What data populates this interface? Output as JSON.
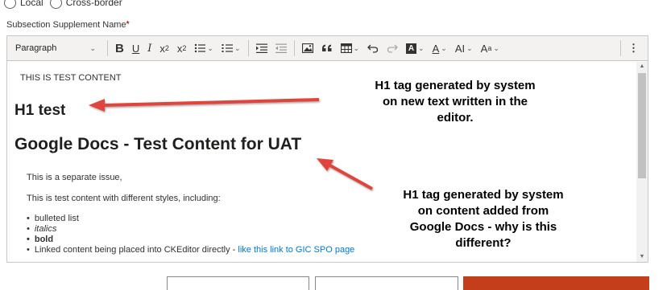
{
  "scope_options": [
    {
      "label": "Local"
    },
    {
      "label": "Cross-border"
    }
  ],
  "field": {
    "label": "Subsection Supplement Name",
    "required_mark": "*"
  },
  "toolbar": {
    "paragraph_select": "Paragraph",
    "bold": "B",
    "underline": "U",
    "italic": "I",
    "subscript": "x",
    "subscript_mark": "2",
    "superscript": "x",
    "superscript_mark": "2",
    "highlight": "A",
    "font_color": "A",
    "font_size": "AI",
    "font_family": "A",
    "more": "⋮"
  },
  "content": {
    "plain_line": "THIS IS TEST CONTENT",
    "h1_a": "H1 test",
    "h1_b": "Google Docs - Test Content for UAT",
    "separate_issue": "This is a separate issue,",
    "description": "This is test content with different styles, including:",
    "bullets": {
      "bulleted": "bulleted list",
      "italics": "italics",
      "bold": "bold",
      "linked_prefix": "Linked content being placed into CKEditor directly - ",
      "linked_link": "like this link to GIC SPO page"
    }
  },
  "annotations": {
    "note1": [
      "H1 tag generated by system",
      "on new text written in the",
      "editor."
    ],
    "note2": [
      "H1 tag generated by system",
      "on content added from",
      "Google Docs - why is this",
      "different?"
    ]
  },
  "colors": {
    "annotation_arrow": "#e0443c",
    "primary_button": "#c43e1c",
    "link": "#0078d4",
    "required": "#a4262c"
  }
}
